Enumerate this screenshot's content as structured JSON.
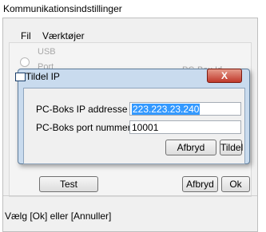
{
  "window": {
    "title": "Kommunikationsindstillinger"
  },
  "menu": {
    "items": [
      {
        "label": "Fil"
      },
      {
        "label": "Værktøjer"
      }
    ]
  },
  "background_panel": {
    "usb_label": "USB",
    "port_label": "Port",
    "pcbox_id_label": "PC-Box Id"
  },
  "buttons": {
    "test": "Test",
    "cancel": "Afbryd",
    "ok": "Ok"
  },
  "status": {
    "text": "Vælg [Ok] eller [Annuller]"
  },
  "dialog": {
    "title": "Tildel IP",
    "close_symbol": "X",
    "ip_label": "PC-Boks IP addresse",
    "ip_value": "223.223.23.240",
    "port_label": "PC-Boks port nummer",
    "port_value": "10001",
    "cancel_label": "Afbryd",
    "assign_label": "Tildel"
  },
  "colors": {
    "selection": "#3399ff",
    "close_button": "#c0392b",
    "dialog_frame": "#c9dbee"
  }
}
